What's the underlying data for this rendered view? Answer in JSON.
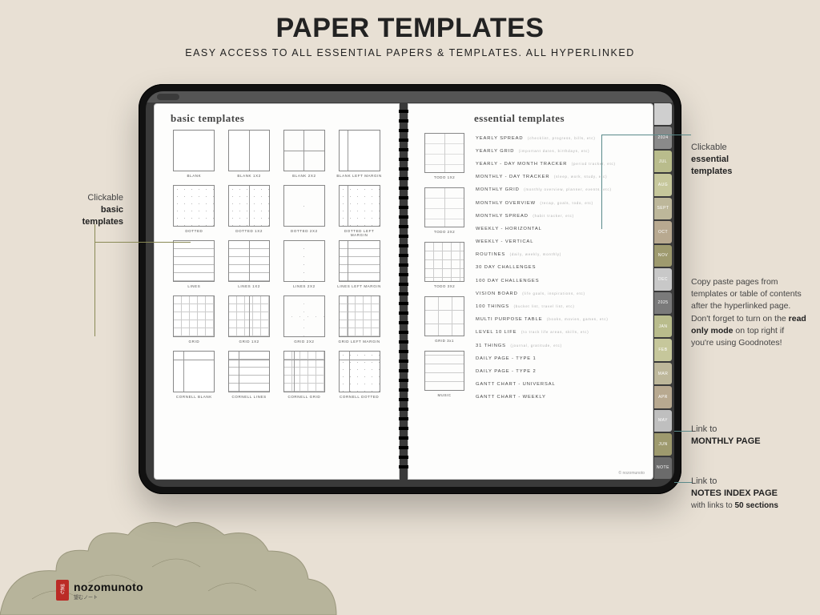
{
  "header": {
    "title": "PAPER TEMPLATES",
    "subtitle": "EASY ACCESS TO ALL ESSENTIAL PAPERS & TEMPLATES. ALL HYPERLINKED"
  },
  "left_page": {
    "title": "basic templates",
    "templates": [
      {
        "label": "BLANK"
      },
      {
        "label": "BLANK 1X2"
      },
      {
        "label": "BLANK 2X2"
      },
      {
        "label": "BLANK LEFT MARGIN"
      },
      {
        "label": "DOTTED"
      },
      {
        "label": "DOTTED 1X2"
      },
      {
        "label": "DOTTED 2X2"
      },
      {
        "label": "DOTTED LEFT MARGIN"
      },
      {
        "label": "LINES"
      },
      {
        "label": "LINES 1X2"
      },
      {
        "label": "LINES 2X2"
      },
      {
        "label": "LINES LEFT MARGIN"
      },
      {
        "label": "GRID"
      },
      {
        "label": "GRID 1X2"
      },
      {
        "label": "GRID 2X2"
      },
      {
        "label": "GRID LEFT MARGIN"
      },
      {
        "label": "CORNELL BLANK"
      },
      {
        "label": "CORNELL LINES"
      },
      {
        "label": "CORNELL GRID"
      },
      {
        "label": "CORNELL DOTTED"
      }
    ]
  },
  "right_page": {
    "title": "essential templates",
    "previews": [
      {
        "label": "TODO 1X2"
      },
      {
        "label": "TODO 2X2"
      },
      {
        "label": "TODO 3X2"
      },
      {
        "label": "GRID 3x1"
      },
      {
        "label": "MUSIC"
      }
    ],
    "items": [
      {
        "name": "YEARLY SPREAD",
        "sub": "(checklist, progress, bills, etc)"
      },
      {
        "name": "YEARLY GRID",
        "sub": "(important dates, birthdays, etc)"
      },
      {
        "name": "YEARLY - DAY MONTH TRACKER",
        "sub": "(period tracker, etc)"
      },
      {
        "name": "MONTHLY - DAY TRACKER",
        "sub": "(sleep, work, study, etc)"
      },
      {
        "name": "MONTHLY GRID",
        "sub": "(monthly overview, planner, events, etc)"
      },
      {
        "name": "MONTHLY OVERVIEW",
        "sub": "(recap, goals, todo, etc)"
      },
      {
        "name": "MONTHLY SPREAD",
        "sub": "(habit tracker, etc)"
      },
      {
        "name": "WEEKLY - HORIZONTAL",
        "sub": ""
      },
      {
        "name": "WEEKLY - VERTICAL",
        "sub": ""
      },
      {
        "name": "ROUTINES",
        "sub": "(daily, weekly, monthly)"
      },
      {
        "name": "30 DAY CHALLENGES",
        "sub": ""
      },
      {
        "name": "100 DAY CHALLENGES",
        "sub": ""
      },
      {
        "name": "VISION BOARD",
        "sub": "(life goals, inspirations, etc)"
      },
      {
        "name": "100 THINGS",
        "sub": "(bucket list, travel list, etc)"
      },
      {
        "name": "MULTI PURPOSE TABLE",
        "sub": "(books, movies, games, etc)"
      },
      {
        "name": "LEVEL 10 LIFE",
        "sub": "(to track life areas, skills, etc)"
      },
      {
        "name": "31 THINGS",
        "sub": "(journal, gratitude, etc)"
      },
      {
        "name": "DAILY PAGE - TYPE 1",
        "sub": ""
      },
      {
        "name": "DAILY PAGE - TYPE 2",
        "sub": ""
      },
      {
        "name": "GANTT CHART - UNIVERSAL",
        "sub": ""
      },
      {
        "name": "GANTT CHART - WEEKLY",
        "sub": ""
      }
    ],
    "credit": "© nozomunoto"
  },
  "side_tabs": [
    {
      "label": "",
      "color": "#cfcfcf"
    },
    {
      "label": "2024",
      "color": "#8a8a8a"
    },
    {
      "label": "JUL",
      "color": "#b9bc8c"
    },
    {
      "label": "AUG",
      "color": "#c6c79b"
    },
    {
      "label": "SEPT",
      "color": "#bdb79a"
    },
    {
      "label": "OCT",
      "color": "#b8a990"
    },
    {
      "label": "NOV",
      "color": "#9e9a6e"
    },
    {
      "label": "DEC",
      "color": "#c8c8c8"
    },
    {
      "label": "2025",
      "color": "#7a7a7a"
    },
    {
      "label": "JAN",
      "color": "#b9bc8c"
    },
    {
      "label": "FEB",
      "color": "#c6c79b"
    },
    {
      "label": "MAR",
      "color": "#bdb79a"
    },
    {
      "label": "APR",
      "color": "#b8a990"
    },
    {
      "label": "MAY",
      "color": "#bfbfbf"
    },
    {
      "label": "JUN",
      "color": "#9e9a6e"
    },
    {
      "label": "NOTE",
      "color": "#6b6b6b"
    }
  ],
  "callouts": {
    "basic": {
      "line1": "Clickable",
      "line2": "basic",
      "line3": "templates"
    },
    "ess": {
      "line1": "Clickable",
      "line2": "essential",
      "line3": "templates"
    },
    "tip": "Copy paste pages from templates or table of contents after the hyperlinked page. Don't forget to turn on the read only mode on top right if you're using Goodnotes!",
    "tip_bold": "read only mode",
    "monthly": {
      "line1": "Link to",
      "line2": "MONTHLY PAGE"
    },
    "notes": {
      "line1": "Link to",
      "line2": "NOTES INDEX PAGE",
      "line3": "with links to 50 sections"
    }
  },
  "brand": {
    "name": "nozomunoto",
    "jp": "望むノート"
  }
}
